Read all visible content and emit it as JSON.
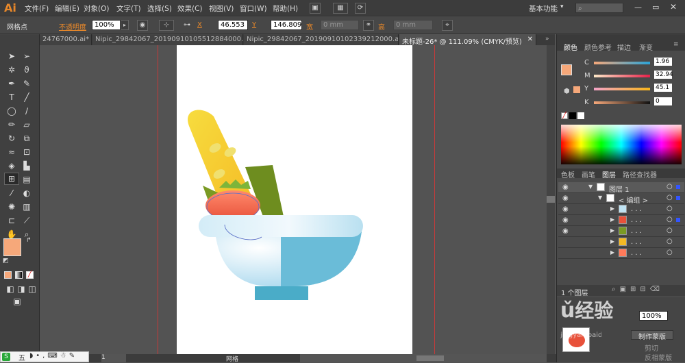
{
  "app": {
    "logo": "Ai"
  },
  "menu": [
    "文件(F)",
    "编辑(E)",
    "对象(O)",
    "文字(T)",
    "选择(S)",
    "效果(C)",
    "视图(V)",
    "窗口(W)",
    "帮助(H)"
  ],
  "workspace": {
    "label": "基本功能"
  },
  "control": {
    "mode_label": "网格点",
    "opacity_label": "不透明度",
    "opacity_value": "100%",
    "x_label": "X",
    "x_value": "46.553",
    "y_label": "Y",
    "y_value": "146.809",
    "w_label": "宽",
    "w_value": "0 mm",
    "h_label": "高",
    "h_value": "0 mm"
  },
  "tabs": [
    {
      "label": "24767000.ai*"
    },
    {
      "label": "Nipic_29842067_20190910105512884000.ai*"
    },
    {
      "label": "Nipic_29842067_20190910102339212000.ai*"
    },
    {
      "label": "未标题-26* @ 111.09% (CMYK/预览)"
    }
  ],
  "color_panel": {
    "tabs": [
      "颜色",
      "颜色参考",
      "描边",
      "渐变"
    ],
    "channels": [
      {
        "name": "C",
        "value": "1.96",
        "pct": 0.02
      },
      {
        "name": "M",
        "value": "32.94",
        "pct": 0.33
      },
      {
        "name": "Y",
        "value": "45.1",
        "pct": 0.45
      },
      {
        "name": "K",
        "value": "0",
        "pct": 0
      }
    ],
    "fill_color": "#f6a87a"
  },
  "layers_panel": {
    "tabs": [
      "色板",
      "画笔",
      "图层",
      "路径查找器"
    ],
    "rows": [
      {
        "label": "图层 1"
      },
      {
        "label": "< 编组 >"
      },
      {
        "label": ". . ."
      },
      {
        "label": ". . ."
      },
      {
        "label": ". . ."
      },
      {
        "label": ". . ."
      },
      {
        "label": ". . ."
      }
    ],
    "count": "1 个图层"
  },
  "transparency": {
    "value": "100%",
    "mask_btn": "制作蒙版",
    "clip_label": "剪切",
    "invert_label": "反相蒙版"
  },
  "watermark": {
    "text": "经验",
    "sub": "jingyan.baidu.com"
  },
  "status": {
    "zoom": "111.09%",
    "tool": "网格"
  },
  "ime": {
    "label": "五"
  }
}
